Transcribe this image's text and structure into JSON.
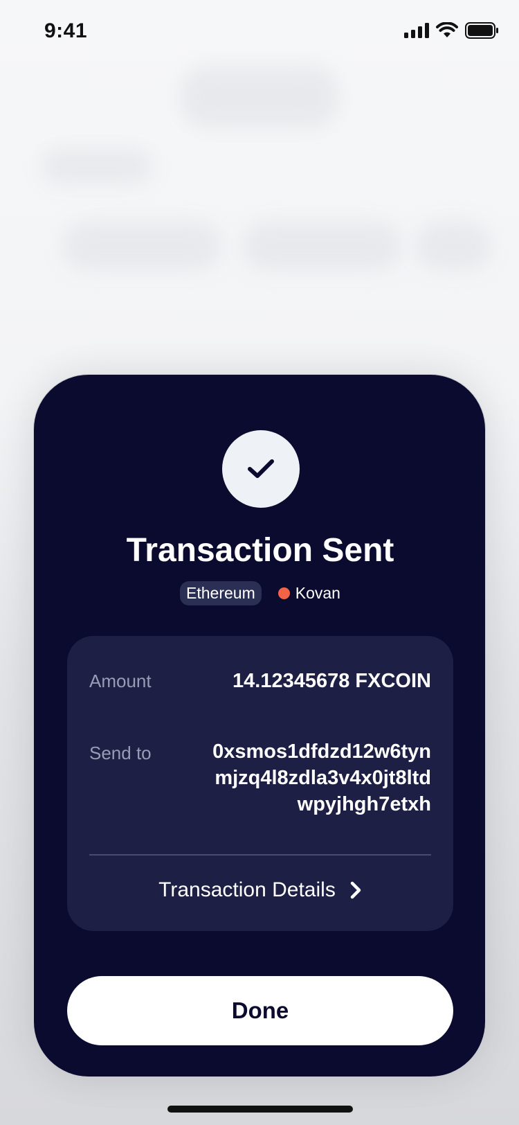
{
  "status_bar": {
    "time": "9:41"
  },
  "modal": {
    "title": "Transaction Sent",
    "chain_badge": "Ethereum",
    "network": "Kovan",
    "network_dot_color": "#f36346",
    "check_icon": "check-icon",
    "amount_label": "Amount",
    "amount_value": "14.12345678 FXCOIN",
    "send_to_label": "Send to",
    "send_to_lines": [
      "0xsmos1dfdzd12w6tyn",
      "mjzq4l8zdla3v4x0jt8ltd",
      "wpyjhgh7etxh"
    ],
    "details_link": "Transaction Details",
    "details_icon": "chevron-right-icon",
    "done_label": "Done"
  },
  "colors": {
    "sheet_bg": "#0a0b2f",
    "card_bg": "#1e1f44",
    "accent_orange": "#f36346"
  }
}
